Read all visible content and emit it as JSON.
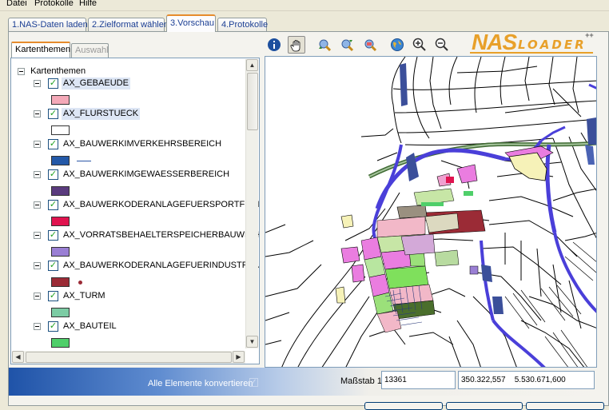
{
  "menu": [
    "Datei",
    "Protokolle",
    "Hilfe"
  ],
  "tabs": [
    "1.NAS-Daten laden",
    "2.Zielformat wählen",
    "3.Vorschau",
    "4.Protokolle"
  ],
  "subtabs": [
    "Kartenthemen",
    "Auswahl"
  ],
  "tree": {
    "root": "Kartenthemen",
    "layers": [
      {
        "name": "AX_GEBAEUDE",
        "fill": "#f4a9b8",
        "selected": true
      },
      {
        "name": "AX_FLURSTUECK",
        "fill": "#ffffff",
        "selected": true
      },
      {
        "name": "AX_BAUWERKIMVERKEHRSBEREICH",
        "fill": "#2459a8",
        "symbol": "line",
        "symbol_color": "#2b57a8"
      },
      {
        "name": "AX_BAUWERKIMGEWAESSERBEREICH",
        "fill": "#5a3b7e"
      },
      {
        "name": "AX_BAUWERKODERANLAGEFUERSPORTFREIZEITU",
        "fill": "#e0134f"
      },
      {
        "name": "AX_VORRATSBEHAELTERSPEICHERBAUWERK",
        "fill": "#9a7fd4"
      },
      {
        "name": "AX_BAUWERKODERANLAGEFUERINDUSTRIEUNDG",
        "fill": "#9b2b36",
        "symbol": "point",
        "symbol_color": "#9b2b36"
      },
      {
        "name": "AX_TURM",
        "fill": "#7ccca4"
      },
      {
        "name": "AX_BAUTEIL",
        "fill": "#4fcf6a"
      }
    ]
  },
  "toolbar": {
    "tools": [
      "info-icon",
      "pan-hand-icon",
      "zoom-previous-icon",
      "zoom-next-icon",
      "zoom-layer-icon",
      "globe-full-extent-icon",
      "zoom-in-icon",
      "zoom-out-icon"
    ],
    "pressed": "pan-hand-icon"
  },
  "logo": {
    "part1": "NAS",
    "part2": "LOADER",
    "suffix": "++",
    "color": "#e8a02a"
  },
  "status": {
    "convert_label": "Alle Elemente konvertieren",
    "convert_checked": true,
    "scale_label": "Maßstab 1:",
    "scale_value": "13361",
    "coord_x": "350.322,557",
    "coord_y": "5.530.671,600"
  },
  "colors": {
    "accent_tab": "#e68b2c",
    "status_gradient_start": "#1f53a8",
    "map_green_line": "#3f6a33",
    "map_blue_water": "#4a3fd9"
  }
}
